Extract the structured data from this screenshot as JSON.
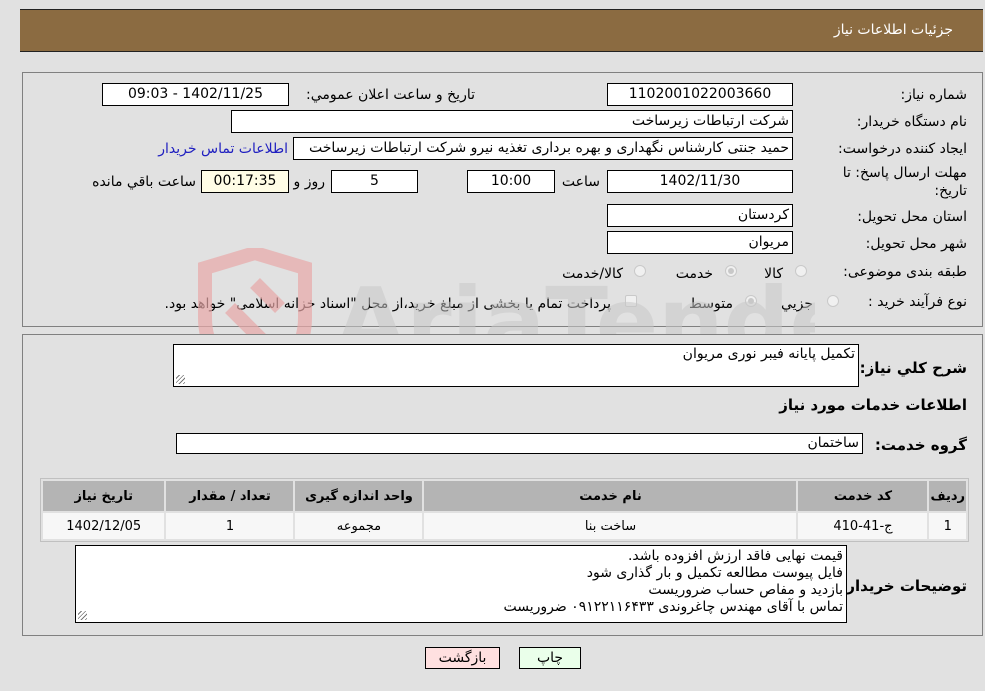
{
  "header": {
    "title": "جزئیات اطلاعات نیاز"
  },
  "form": {
    "need_number": {
      "label": "شماره نیاز:",
      "value": "1102001022003660"
    },
    "announce_datetime": {
      "label": "تاریخ و ساعت اعلان عمومي:",
      "value": "1402/11/25 - 09:03"
    },
    "buyer_org": {
      "label": "نام دستگاه خريدار:",
      "value": "شرکت ارتباطات زیرساخت"
    },
    "requester": {
      "label": "ایجاد کننده درخواست:",
      "value": "حمید جنتی کارشناس نگهداری و بهره برداری تغذیه نیرو شرکت ارتباطات زیرساخت",
      "contact_link": "اطلاعات تماس خریدار"
    },
    "deadline": {
      "label_line1": "مهلت ارسال پاسخ: تا",
      "label_line2": "تاریخ:",
      "date": "1402/11/30",
      "time_label": "ساعت",
      "time": "10:00",
      "days": "5",
      "days_label": "روز و",
      "remaining": "00:17:35",
      "remaining_label": "ساعت باقي مانده"
    },
    "province": {
      "label": "استان محل تحویل:",
      "value": "کردستان"
    },
    "city": {
      "label": "شهر محل تحویل:",
      "value": "مریوان"
    },
    "category": {
      "label": "طبقه بندی موضوعی:",
      "options": [
        {
          "label": "کالا",
          "checked": false
        },
        {
          "label": "خدمت",
          "checked": true
        },
        {
          "label": "کالا/خدمت",
          "checked": false
        }
      ]
    },
    "purchase_type": {
      "label": "نوع فرآیند خرید :",
      "options": [
        {
          "label": "جزیي",
          "checked": false
        },
        {
          "label": "متوسط",
          "checked": true
        }
      ],
      "treasury_note": "پرداخت تمام یا بخشی از مبلغ خرید،از محل \"اسناد خزانه اسلامی\" خواهد بود.",
      "treasury_checked": false
    }
  },
  "details": {
    "summary_label": "شرح کلي نياز:",
    "summary_value": "تکمیل پایانه فیبر نوری مریوان",
    "services_heading": "اطلاعات خدمات مورد نیاز",
    "service_group_label": "گروه خدمت:",
    "service_group_value": "ساختمان",
    "table": {
      "headers": [
        "ردیف",
        "کد خدمت",
        "نام خدمت",
        "واحد اندازه گیری",
        "تعداد / مقدار",
        "تاریخ نیاز"
      ],
      "rows": [
        [
          "1",
          "ج-41-410",
          "ساخت بنا",
          "مجموعه",
          "1",
          "1402/12/05"
        ]
      ]
    },
    "buyer_notes_label": "توضیحات خریدار:",
    "buyer_notes": [
      "قیمت نهایی فاقد ارزش افزوده باشد.",
      "فایل پیوست مطالعه تکمیل و بار گذاری شود",
      "بازدید و مفاص حساب ضروریست",
      "تماس با آقای مهندس چاغروندی ۰۹۱۲۲۱۱۶۴۳۳ ضروریست"
    ]
  },
  "buttons": {
    "print": "چاپ",
    "back": "بازگشت"
  },
  "watermark": {
    "text": "AriaTender.net"
  }
}
